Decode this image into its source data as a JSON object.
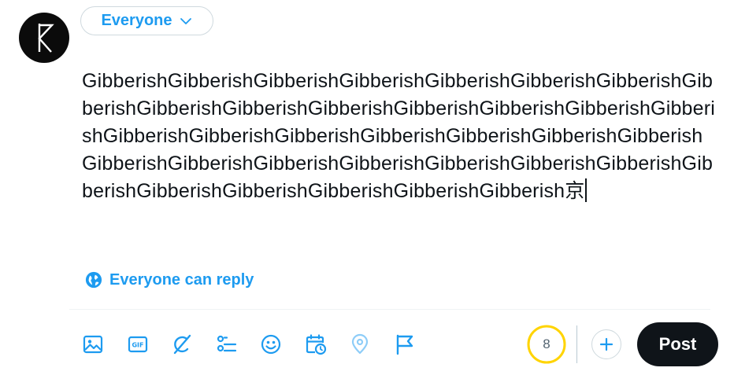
{
  "audience": {
    "label": "Everyone",
    "icon": "chevron-down-icon"
  },
  "compose": {
    "text": "GibberishGibberishGibberishGibberishGibberishGibberishGibberishGibberishGibberishGibberishGibberishGibberishGibberishGibberishGibberishGibberishGibberishGibberishGibberishGibberishGibberishGibberishGibberishGibberishGibberishGibberishGibberishGibberishGibberishGibberishGibberishGibberishGibberishGibberishGibberish京"
  },
  "reply_setting": {
    "label": "Everyone can reply",
    "icon": "globe-icon"
  },
  "toolbar": {
    "tools": [
      "image-icon",
      "gif-icon",
      "grok-icon",
      "poll-icon",
      "emoji-icon",
      "schedule-icon",
      "location-icon",
      "flag-icon"
    ]
  },
  "char_counter": {
    "remaining": "8",
    "color": "#ffd400"
  },
  "add_post": {
    "icon": "plus-icon"
  },
  "post_button": {
    "label": "Post"
  },
  "colors": {
    "accent": "#1d9bf0",
    "text": "#0f1419",
    "border": "#cfd9de",
    "counter_warning": "#ffd400"
  }
}
